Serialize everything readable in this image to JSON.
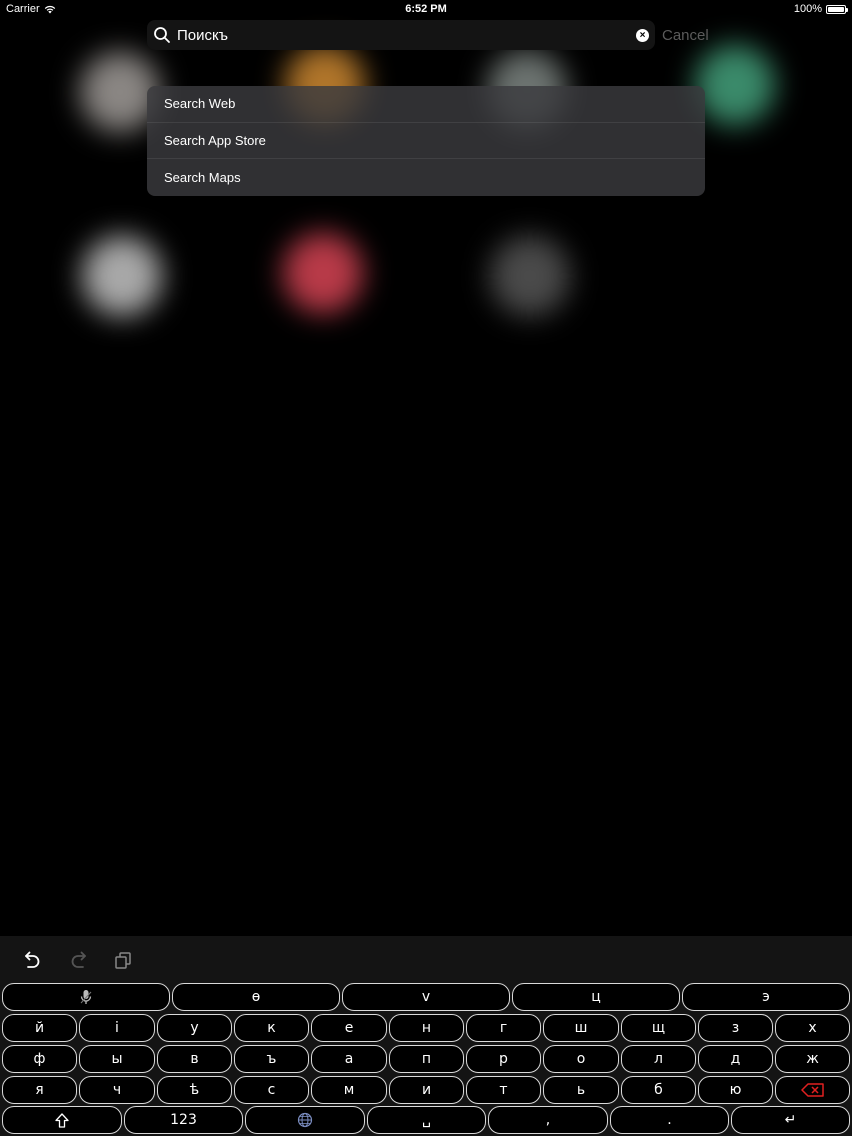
{
  "status_bar": {
    "carrier": "Carrier",
    "time": "6:52 PM",
    "battery_percent": "100%",
    "battery_level": 1.0
  },
  "search": {
    "query": "Поискъ",
    "cancel_label": "Cancel"
  },
  "suggestions": [
    {
      "label": "Search Web"
    },
    {
      "label": "Search App Store"
    },
    {
      "label": "Search Maps"
    }
  ],
  "keyboard": {
    "toolbar": {
      "undo_icon": "undo-icon",
      "redo_icon": "redo-icon",
      "copy_icon": "copy-icon"
    },
    "row0": [
      "",
      "ө",
      "v",
      "ц",
      "э"
    ],
    "row1": [
      "й",
      "і",
      "у",
      "к",
      "е",
      "н",
      "г",
      "ш",
      "щ",
      "з",
      "х"
    ],
    "row2": [
      "ф",
      "ы",
      "в",
      "ъ",
      "а",
      "п",
      "р",
      "о",
      "л",
      "д",
      "ж"
    ],
    "row3": [
      "я",
      "ч",
      "ѣ",
      "с",
      "м",
      "и",
      "т",
      "ь",
      "б",
      "ю",
      ""
    ],
    "row4": [
      "",
      "123",
      "",
      "␣",
      ",",
      ".",
      "↵"
    ],
    "delete_color": "#e02020"
  },
  "colors": {
    "background": "#000000",
    "cancel_text": "#5b5b5b",
    "key_border": "#d9d9d9"
  }
}
